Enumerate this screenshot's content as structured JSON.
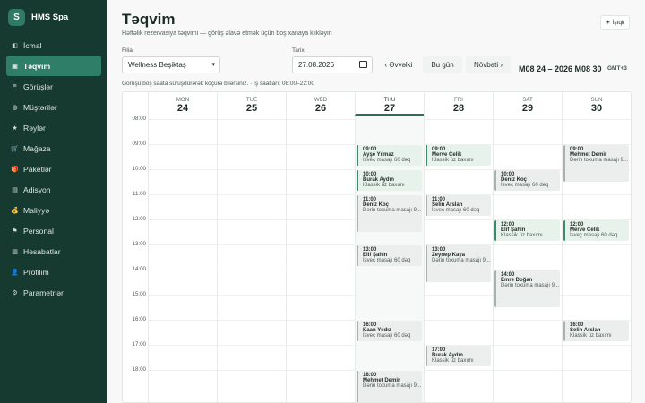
{
  "brand": {
    "initial": "S",
    "name": "HMS Spa"
  },
  "nav": [
    {
      "label": "İcmal",
      "icon": "dashboard-icon",
      "glyph": "◧"
    },
    {
      "label": "Təqvim",
      "icon": "calendar-icon",
      "glyph": "▣",
      "active": true
    },
    {
      "label": "Görüşlər",
      "icon": "list-icon",
      "glyph": "≡"
    },
    {
      "label": "Müştərilər",
      "icon": "users-icon",
      "glyph": "◍"
    },
    {
      "label": "Rəylər",
      "icon": "star-icon",
      "glyph": "★"
    },
    {
      "label": "Mağaza",
      "icon": "cart-icon",
      "glyph": "🛒"
    },
    {
      "label": "Paketlər",
      "icon": "gift-icon",
      "glyph": "🎁"
    },
    {
      "label": "Adisyon",
      "icon": "receipt-icon",
      "glyph": "▤"
    },
    {
      "label": "Maliyyə",
      "icon": "money-bag-icon",
      "glyph": "💰"
    },
    {
      "label": "Personal",
      "icon": "flag-icon",
      "glyph": "⚑"
    },
    {
      "label": "Hesabatlar",
      "icon": "bar-chart-icon",
      "glyph": "▥"
    },
    {
      "label": "Profilim",
      "icon": "profile-icon",
      "glyph": "👤"
    },
    {
      "label": "Parametrlər",
      "icon": "gear-icon",
      "glyph": "⚙"
    }
  ],
  "header": {
    "title": "Təqvim",
    "subtitle": "Həftəlik rezervasiya təqvimi — görüş əlavə etmək üçün boş xanaya klikləyin",
    "lang_label": "İşıqlı",
    "lang_glyph": "☀"
  },
  "filters": {
    "branch_label": "Filial",
    "branch_value": "Wellness Beşiktaş",
    "date_label": "Tarix",
    "date_value": "27.08.2026"
  },
  "nav_buttons": {
    "prev": "‹ Əvvəlki",
    "today": "Bu gün",
    "next": "Növbəti ›"
  },
  "range": "M08 24 – 2026 M08 30",
  "timezone": "GMT+3",
  "hint": "Görüşü boş saata sürüşdürərək köçürə bilərsiniz. · İş saatları: 08:00–22:00",
  "days": [
    {
      "name": "MON",
      "num": "24"
    },
    {
      "name": "TUE",
      "num": "25"
    },
    {
      "name": "WED",
      "num": "26"
    },
    {
      "name": "THU",
      "num": "27",
      "today": true
    },
    {
      "name": "FRI",
      "num": "28"
    },
    {
      "name": "SAT",
      "num": "29"
    },
    {
      "name": "SUN",
      "num": "30"
    }
  ],
  "times": [
    "08:00",
    "09:00",
    "10:00",
    "11:00",
    "12:00",
    "13:00",
    "14:00",
    "15:00",
    "16:00",
    "17:00",
    "18:00"
  ],
  "events": [
    {
      "day": 3,
      "time": "09:00",
      "name": "Ayşe Yılmaz",
      "service": "İsveç masajı 60 dəq",
      "style": "sig"
    },
    {
      "day": 3,
      "time": "10:00",
      "name": "Burak Aydın",
      "service": "Klassik üz baxımı",
      "style": "sig"
    },
    {
      "day": 3,
      "time": "11:00",
      "name": "Deniz Koç",
      "service": "Dərin toxuma masajı 9...",
      "style": "reg",
      "tall": true
    },
    {
      "day": 3,
      "time": "13:00",
      "name": "Elif Şahin",
      "service": "İsveç masajı 60 dəq",
      "style": "reg"
    },
    {
      "day": 3,
      "time": "16:00",
      "name": "Kaan Yıldız",
      "service": "İsveç masajı 60 dəq",
      "style": "reg"
    },
    {
      "day": 3,
      "time": "18:00",
      "name": "Mehmet Demir",
      "service": "Dərin toxuma masajı 9...",
      "style": "reg",
      "tall": true
    },
    {
      "day": 4,
      "time": "09:00",
      "name": "Merve Çelik",
      "service": "Klassik üz baxımı",
      "style": "sig"
    },
    {
      "day": 4,
      "time": "11:00",
      "name": "Selin Arslan",
      "service": "İsveç masajı 60 dəq",
      "style": "reg"
    },
    {
      "day": 4,
      "time": "13:00",
      "name": "Zeynep Kaya",
      "service": "Dərin toxuma masajı 9...",
      "style": "reg",
      "tall": true
    },
    {
      "day": 4,
      "time": "17:00",
      "name": "Burak Aydın",
      "service": "Klassik üz baxımı",
      "style": "reg"
    },
    {
      "day": 5,
      "time": "10:00",
      "name": "Deniz Koç",
      "service": "İsveç masajı 60 dəq",
      "style": "reg"
    },
    {
      "day": 5,
      "time": "12:00",
      "name": "Elif Şahin",
      "service": "Klassik üz baxımı",
      "style": "sig"
    },
    {
      "day": 5,
      "time": "14:00",
      "name": "Emre Doğan",
      "service": "Dərin toxuma masajı 9...",
      "style": "reg",
      "tall": true
    },
    {
      "day": 6,
      "time": "09:00",
      "name": "Mehmet Demir",
      "service": "Dərin toxuma masajı 9...",
      "style": "reg",
      "tall": true
    },
    {
      "day": 6,
      "time": "12:00",
      "name": "Merve Çelik",
      "service": "İsveç masajı 60 dəq",
      "style": "sig"
    },
    {
      "day": 6,
      "time": "16:00",
      "name": "Selin Arslan",
      "service": "Klassik üz baxımı",
      "style": "reg"
    }
  ]
}
